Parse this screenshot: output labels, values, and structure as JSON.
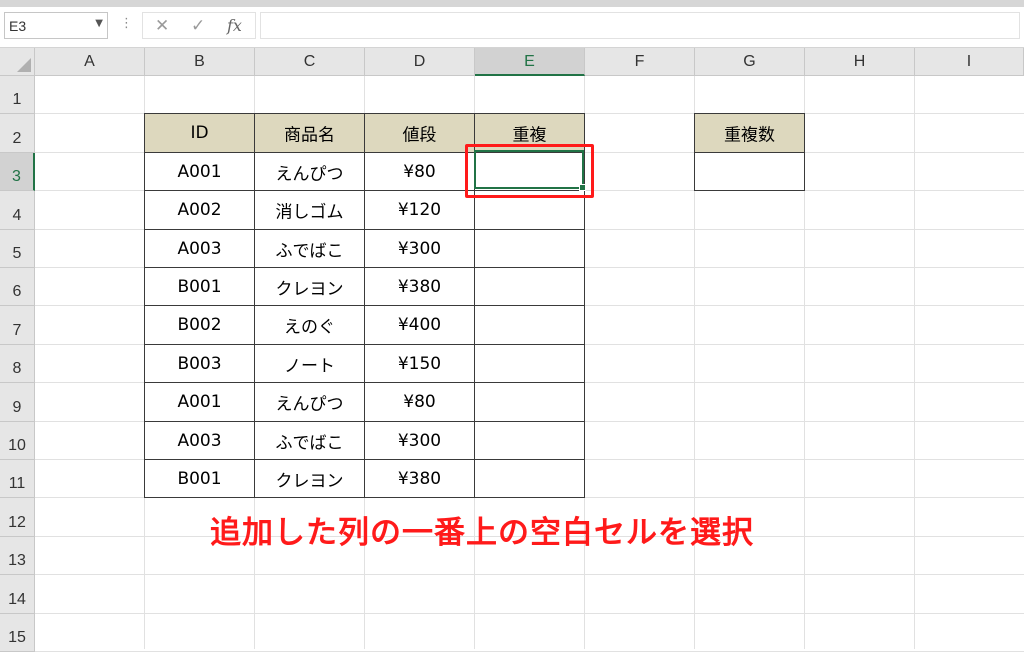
{
  "formula_bar": {
    "name_box": "E3",
    "cancel_icon": "✕",
    "enter_icon": "✓",
    "function_icon": "fx",
    "formula": ""
  },
  "columns": [
    "A",
    "B",
    "C",
    "D",
    "E",
    "F",
    "G",
    "H",
    "I"
  ],
  "rows": [
    "1",
    "2",
    "3",
    "4",
    "5",
    "6",
    "7",
    "8",
    "9",
    "10",
    "11",
    "12",
    "13",
    "14",
    "15"
  ],
  "selected_cell": "E3",
  "table": {
    "headers": [
      "ID",
      "商品名",
      "値段",
      "重複"
    ],
    "rows": [
      [
        "A001",
        "えんぴつ",
        "¥80",
        ""
      ],
      [
        "A002",
        "消しゴム",
        "¥120",
        ""
      ],
      [
        "A003",
        "ふでばこ",
        "¥300",
        ""
      ],
      [
        "B001",
        "クレヨン",
        "¥380",
        ""
      ],
      [
        "B002",
        "えのぐ",
        "¥400",
        ""
      ],
      [
        "B003",
        "ノート",
        "¥150",
        ""
      ],
      [
        "A001",
        "えんぴつ",
        "¥80",
        ""
      ],
      [
        "A003",
        "ふでばこ",
        "¥300",
        ""
      ],
      [
        "B001",
        "クレヨン",
        "¥380",
        ""
      ]
    ]
  },
  "count_table": {
    "header": "重複数",
    "value": ""
  },
  "annotation": "追加した列の一番上の空白セルを選択",
  "colors": {
    "header_fill": "#ddd8be",
    "selection": "#217346",
    "annotation": "#ff1a1a"
  }
}
